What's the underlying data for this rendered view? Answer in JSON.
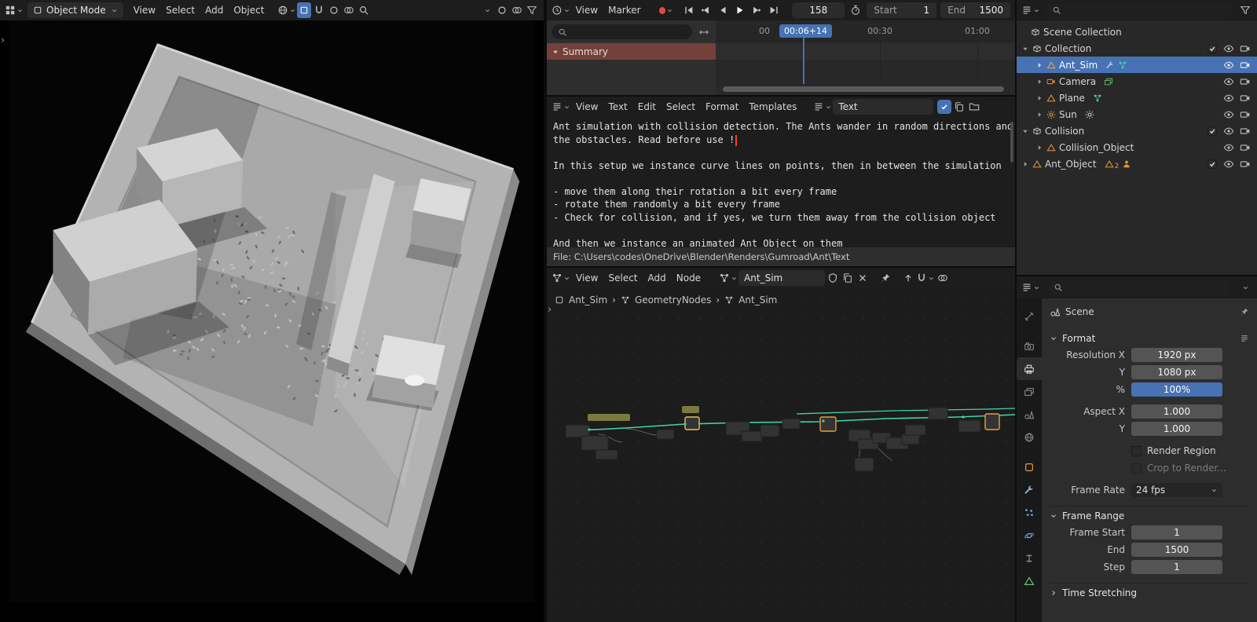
{
  "colors": {
    "accent": "#4772b3",
    "object_orange": "#e8953c",
    "node_link_green": "#43d3a5",
    "channel_red": "#73413a"
  },
  "viewport3d": {
    "mode": "Object Mode",
    "menus": [
      "View",
      "Select",
      "Add",
      "Object"
    ]
  },
  "timeline": {
    "menus": [
      "View",
      "Marker"
    ],
    "frame": "158",
    "start_label": "Start",
    "start_value": "1",
    "end_label": "End",
    "end_value": "1500",
    "ruler": {
      "tick_left": "00",
      "current": "00:06+14",
      "tick_mid": "00:30",
      "tick_end": "01:00"
    },
    "channel": "Summary"
  },
  "text_editor": {
    "menus": [
      "View",
      "Text",
      "Edit",
      "Select",
      "Format",
      "Templates"
    ],
    "datablock": "Text",
    "lines": [
      "Ant simulation with collision detection. The Ants wander in random directions and",
      "the obstacles. Read before use !",
      "",
      "In this setup we instance curve lines on points, then in between the simulation",
      "",
      "- move them along their rotation a bit every frame",
      "- rotate them randomly a bit every frame",
      "- Check for collision, and if yes, we turn them away from the collision object",
      "",
      "And then we instance an animated Ant Object on them"
    ],
    "footer": "File: C:\\Users\\codes\\OneDrive\\Blender\\Renders\\Gumroad\\Ant\\Text"
  },
  "node_editor": {
    "menus": [
      "View",
      "Select",
      "Add",
      "Node"
    ],
    "datablock": "Ant_Sim",
    "breadcrumb": [
      "Ant_Sim",
      "GeometryNodes",
      "Ant_Sim"
    ]
  },
  "outliner": {
    "rows": [
      {
        "label": "Scene Collection"
      },
      {
        "label": "Collection"
      },
      {
        "label": "Ant_Sim"
      },
      {
        "label": "Camera"
      },
      {
        "label": "Plane"
      },
      {
        "label": "Sun"
      },
      {
        "label": "Collision"
      },
      {
        "label": "Collision_Object"
      },
      {
        "label": "Ant_Object",
        "count": "2"
      }
    ]
  },
  "properties": {
    "scene": "Scene",
    "format": {
      "title": "Format",
      "fields": [
        {
          "label": "Resolution X",
          "value": "1920 px"
        },
        {
          "label": "Y",
          "value": "1080 px"
        },
        {
          "label": "%",
          "value": "100%"
        },
        {
          "label": "Aspect X",
          "value": "1.000"
        },
        {
          "label": "Y",
          "value": "1.000"
        }
      ],
      "checkboxes": [
        "Render Region",
        "Crop to Render..."
      ],
      "framerate_label": "Frame Rate",
      "framerate_value": "24 fps"
    },
    "frame_range": {
      "title": "Frame Range",
      "fields": [
        {
          "label": "Frame Start",
          "value": "1"
        },
        {
          "label": "End",
          "value": "1500"
        },
        {
          "label": "Step",
          "value": "1"
        }
      ]
    },
    "time_stretching": "Time Stretching"
  }
}
